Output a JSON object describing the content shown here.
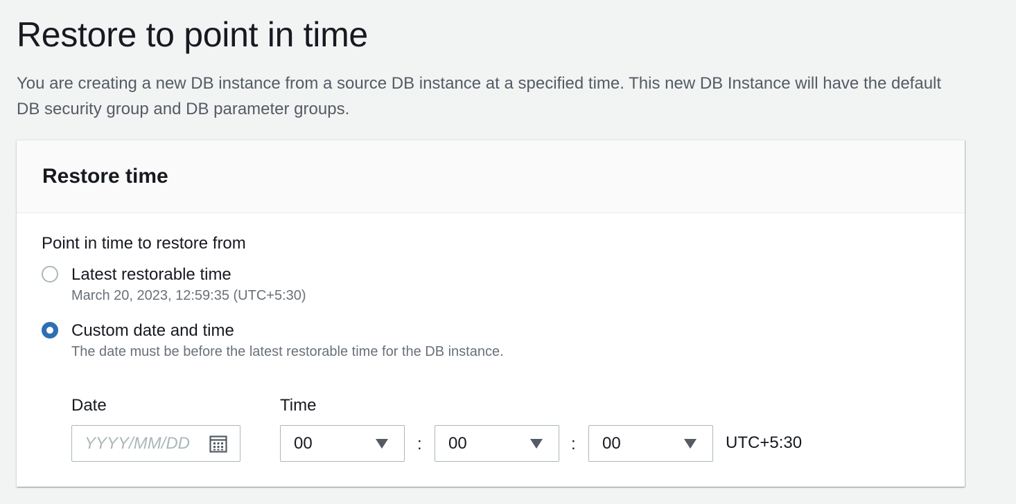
{
  "header": {
    "title": "Restore to point in time",
    "description": "You are creating a new DB instance from a source DB instance at a specified time. This new DB Instance will have the default DB security group and DB parameter groups."
  },
  "panel": {
    "title": "Restore time",
    "restore_point_label": "Point in time to restore from",
    "options": [
      {
        "label": "Latest restorable time",
        "description": "March 20, 2023, 12:59:35 (UTC+5:30)",
        "selected": false
      },
      {
        "label": "Custom date and time",
        "description": "The date must be before the latest restorable time for the DB instance.",
        "selected": true
      }
    ],
    "date": {
      "label": "Date",
      "value": "",
      "placeholder": "YYYY/MM/DD",
      "icon": "calendar-icon"
    },
    "time": {
      "label": "Time",
      "hours": "00",
      "minutes": "00",
      "seconds": "00",
      "separator": ":",
      "timezone": "UTC+5:30",
      "icon": "caret-down-icon"
    }
  },
  "colors": {
    "background": "#f2f3f3",
    "panel_header": "#fafafa",
    "radio_selected": "#2e6fb4",
    "text_primary": "#16191f",
    "text_secondary": "#687078",
    "border": "#aab7b8"
  }
}
